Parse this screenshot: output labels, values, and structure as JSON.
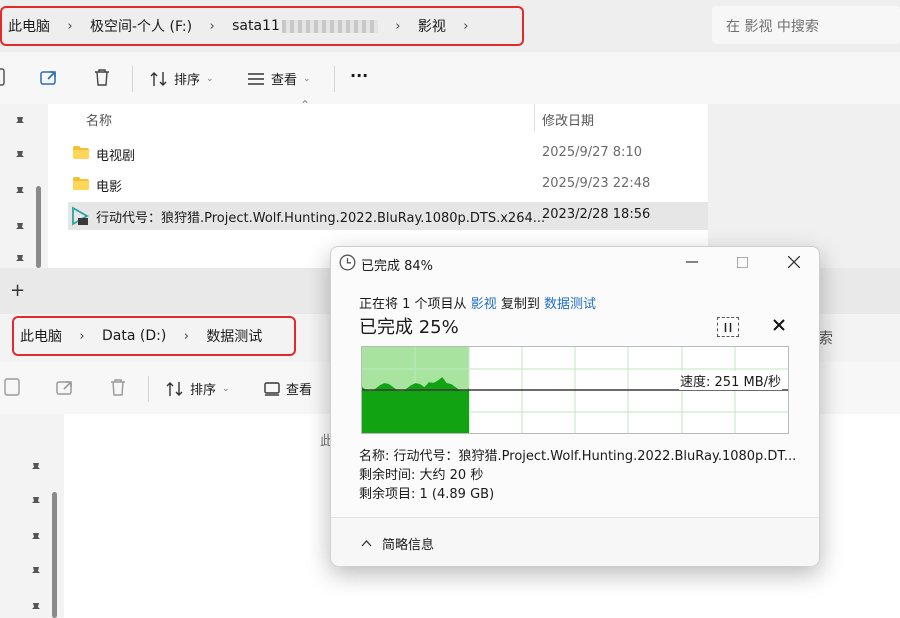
{
  "top_window": {
    "breadcrumb": [
      "此电脑",
      "极空间-个人 (F:)",
      "sata11",
      "影视"
    ],
    "search_placeholder": "在 影视 中搜索",
    "toolbar": {
      "sort_label": "排序",
      "view_label": "查看",
      "more_label": "···"
    },
    "columns": {
      "name": "名称",
      "date": "修改日期"
    },
    "files": [
      {
        "name": "电视剧",
        "date": "2025/9/27 8:10",
        "type": "folder"
      },
      {
        "name": "电影",
        "date": "2025/9/23 22:48",
        "type": "folder"
      },
      {
        "name": "行动代号：狼狩猎.Project.Wolf.Hunting.2022.BluRay.1080p.DTS.x264...",
        "date": "2023/2/28 18:56",
        "type": "video"
      }
    ]
  },
  "bottom_window": {
    "new_tab_label": "+",
    "breadcrumb": [
      "此电脑",
      "Data (D:)",
      "数据测试"
    ],
    "search_fragment": "索",
    "toolbar": {
      "sort_label": "排序",
      "view_label": "查看"
    },
    "main_fragment": "此"
  },
  "copy_dialog": {
    "title": "已完成 84%",
    "copy_prefix": "正在将 1 个项目从",
    "source": "影视",
    "copy_mid": "复制到",
    "destination": "数据测试",
    "progress_text": "已完成 25%",
    "progress_fraction": 0.25,
    "speed": "速度: 251 MB/秒",
    "name_label": "名称:",
    "name_value": "行动代号：狼狩猎.Project.Wolf.Hunting.2022.BluRay.1080p.DT...",
    "time_label": "剩余时间:",
    "time_value": "大约 20 秒",
    "items_label": "剩余项目:",
    "items_value": "1 (4.89 GB)",
    "details_label": "简略信息",
    "colors": {
      "graph_fill": "#12a312",
      "graph_progress": "#a8e4a0",
      "grid": "#bfe7bf"
    }
  }
}
